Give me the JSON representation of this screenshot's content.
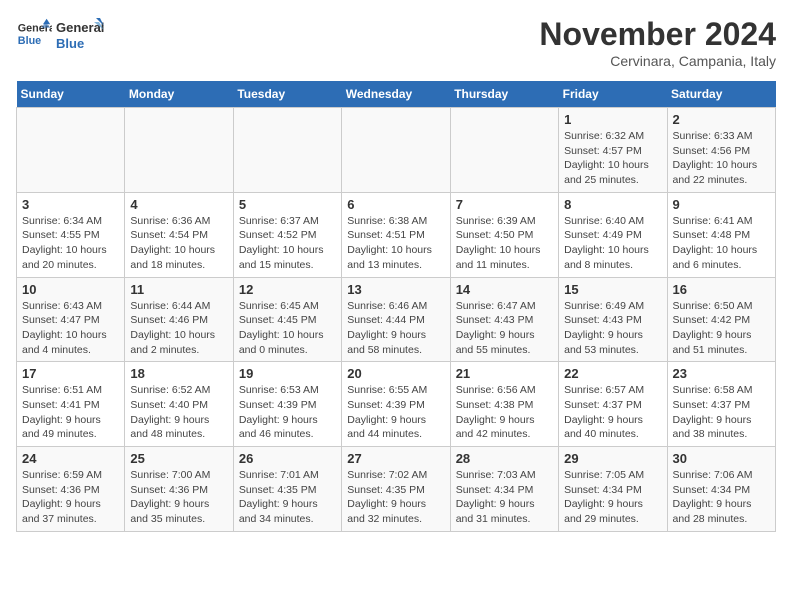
{
  "logo": {
    "line1": "General",
    "line2": "Blue"
  },
  "title": "November 2024",
  "subtitle": "Cervinara, Campania, Italy",
  "weekdays": [
    "Sunday",
    "Monday",
    "Tuesday",
    "Wednesday",
    "Thursday",
    "Friday",
    "Saturday"
  ],
  "weeks": [
    [
      {
        "day": "",
        "info": ""
      },
      {
        "day": "",
        "info": ""
      },
      {
        "day": "",
        "info": ""
      },
      {
        "day": "",
        "info": ""
      },
      {
        "day": "",
        "info": ""
      },
      {
        "day": "1",
        "info": "Sunrise: 6:32 AM\nSunset: 4:57 PM\nDaylight: 10 hours\nand 25 minutes."
      },
      {
        "day": "2",
        "info": "Sunrise: 6:33 AM\nSunset: 4:56 PM\nDaylight: 10 hours\nand 22 minutes."
      }
    ],
    [
      {
        "day": "3",
        "info": "Sunrise: 6:34 AM\nSunset: 4:55 PM\nDaylight: 10 hours\nand 20 minutes."
      },
      {
        "day": "4",
        "info": "Sunrise: 6:36 AM\nSunset: 4:54 PM\nDaylight: 10 hours\nand 18 minutes."
      },
      {
        "day": "5",
        "info": "Sunrise: 6:37 AM\nSunset: 4:52 PM\nDaylight: 10 hours\nand 15 minutes."
      },
      {
        "day": "6",
        "info": "Sunrise: 6:38 AM\nSunset: 4:51 PM\nDaylight: 10 hours\nand 13 minutes."
      },
      {
        "day": "7",
        "info": "Sunrise: 6:39 AM\nSunset: 4:50 PM\nDaylight: 10 hours\nand 11 minutes."
      },
      {
        "day": "8",
        "info": "Sunrise: 6:40 AM\nSunset: 4:49 PM\nDaylight: 10 hours\nand 8 minutes."
      },
      {
        "day": "9",
        "info": "Sunrise: 6:41 AM\nSunset: 4:48 PM\nDaylight: 10 hours\nand 6 minutes."
      }
    ],
    [
      {
        "day": "10",
        "info": "Sunrise: 6:43 AM\nSunset: 4:47 PM\nDaylight: 10 hours\nand 4 minutes."
      },
      {
        "day": "11",
        "info": "Sunrise: 6:44 AM\nSunset: 4:46 PM\nDaylight: 10 hours\nand 2 minutes."
      },
      {
        "day": "12",
        "info": "Sunrise: 6:45 AM\nSunset: 4:45 PM\nDaylight: 10 hours\nand 0 minutes."
      },
      {
        "day": "13",
        "info": "Sunrise: 6:46 AM\nSunset: 4:44 PM\nDaylight: 9 hours\nand 58 minutes."
      },
      {
        "day": "14",
        "info": "Sunrise: 6:47 AM\nSunset: 4:43 PM\nDaylight: 9 hours\nand 55 minutes."
      },
      {
        "day": "15",
        "info": "Sunrise: 6:49 AM\nSunset: 4:43 PM\nDaylight: 9 hours\nand 53 minutes."
      },
      {
        "day": "16",
        "info": "Sunrise: 6:50 AM\nSunset: 4:42 PM\nDaylight: 9 hours\nand 51 minutes."
      }
    ],
    [
      {
        "day": "17",
        "info": "Sunrise: 6:51 AM\nSunset: 4:41 PM\nDaylight: 9 hours\nand 49 minutes."
      },
      {
        "day": "18",
        "info": "Sunrise: 6:52 AM\nSunset: 4:40 PM\nDaylight: 9 hours\nand 48 minutes."
      },
      {
        "day": "19",
        "info": "Sunrise: 6:53 AM\nSunset: 4:39 PM\nDaylight: 9 hours\nand 46 minutes."
      },
      {
        "day": "20",
        "info": "Sunrise: 6:55 AM\nSunset: 4:39 PM\nDaylight: 9 hours\nand 44 minutes."
      },
      {
        "day": "21",
        "info": "Sunrise: 6:56 AM\nSunset: 4:38 PM\nDaylight: 9 hours\nand 42 minutes."
      },
      {
        "day": "22",
        "info": "Sunrise: 6:57 AM\nSunset: 4:37 PM\nDaylight: 9 hours\nand 40 minutes."
      },
      {
        "day": "23",
        "info": "Sunrise: 6:58 AM\nSunset: 4:37 PM\nDaylight: 9 hours\nand 38 minutes."
      }
    ],
    [
      {
        "day": "24",
        "info": "Sunrise: 6:59 AM\nSunset: 4:36 PM\nDaylight: 9 hours\nand 37 minutes."
      },
      {
        "day": "25",
        "info": "Sunrise: 7:00 AM\nSunset: 4:36 PM\nDaylight: 9 hours\nand 35 minutes."
      },
      {
        "day": "26",
        "info": "Sunrise: 7:01 AM\nSunset: 4:35 PM\nDaylight: 9 hours\nand 34 minutes."
      },
      {
        "day": "27",
        "info": "Sunrise: 7:02 AM\nSunset: 4:35 PM\nDaylight: 9 hours\nand 32 minutes."
      },
      {
        "day": "28",
        "info": "Sunrise: 7:03 AM\nSunset: 4:34 PM\nDaylight: 9 hours\nand 31 minutes."
      },
      {
        "day": "29",
        "info": "Sunrise: 7:05 AM\nSunset: 4:34 PM\nDaylight: 9 hours\nand 29 minutes."
      },
      {
        "day": "30",
        "info": "Sunrise: 7:06 AM\nSunset: 4:34 PM\nDaylight: 9 hours\nand 28 minutes."
      }
    ]
  ]
}
